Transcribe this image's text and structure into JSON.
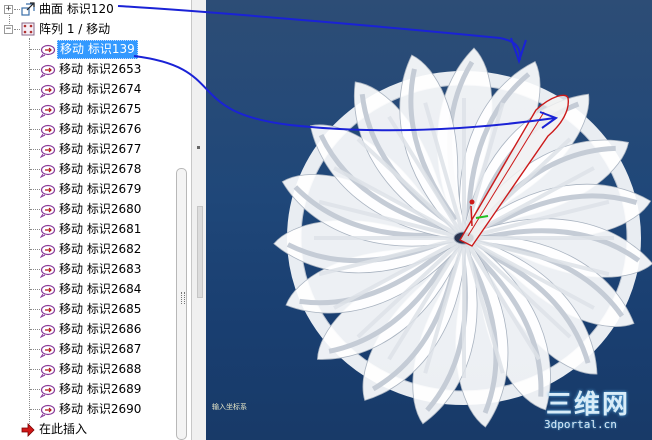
{
  "tree": {
    "surface_item": {
      "label": "曲面 标识120",
      "expander": "+"
    },
    "pattern_item": {
      "label": "阵列 1 / 移动",
      "expander": "−"
    },
    "move_items": [
      "移动 标识139",
      "移动 标识2653",
      "移动 标识2674",
      "移动 标识2675",
      "移动 标识2676",
      "移动 标识2677",
      "移动 标识2678",
      "移动 标识2679",
      "移动 标识2680",
      "移动 标识2681",
      "移动 标识2682",
      "移动 标识2683",
      "移动 标识2684",
      "移动 标识2685",
      "移动 标识2686",
      "移动 标识2687",
      "移动 标识2688",
      "移动 标识2689",
      "移动 标识2690"
    ],
    "selected_index": 0,
    "insert_here": {
      "label": "在此插入"
    }
  },
  "viewport": {
    "background": "#1f4779",
    "coord_label": "输入坐标系",
    "watermark": {
      "logo": "三维网",
      "url": "3dportal.cn"
    }
  },
  "colors": {
    "selection": "#3399ff",
    "annotation_arrow": "#1a22d6",
    "highlight_outline": "#cc1a1a",
    "model_fill": "#ffffff"
  }
}
